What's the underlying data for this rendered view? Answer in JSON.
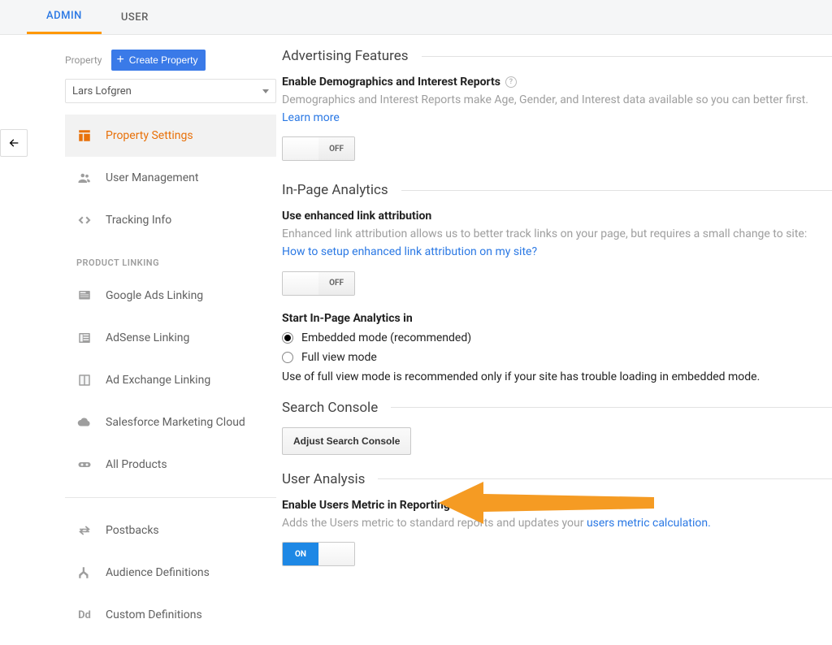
{
  "tabs": {
    "admin": "ADMIN",
    "user": "USER"
  },
  "sidebar": {
    "property_label": "Property",
    "create_btn": "Create Property",
    "selected_property": "Lars Lofgren",
    "items": {
      "settings": "Property Settings",
      "users": "User Management",
      "tracking": "Tracking Info",
      "linking_header": "PRODUCT LINKING",
      "ads": "Google Ads Linking",
      "adsense": "AdSense Linking",
      "adx": "Ad Exchange Linking",
      "sfmc": "Salesforce Marketing Cloud",
      "all": "All Products",
      "postbacks": "Postbacks",
      "audience": "Audience Definitions",
      "custom": "Custom Definitions"
    }
  },
  "sections": {
    "adv": {
      "title": "Advertising Features",
      "demo_label": "Enable Demographics and Interest Reports",
      "demo_desc": "Demographics and Interest Reports make Age, Gender, and Interest data available so you can better first. ",
      "learn_more": "Learn more",
      "off": "OFF"
    },
    "inpage": {
      "title": "In-Page Analytics",
      "ela_label": "Use enhanced link attribution",
      "ela_desc": "Enhanced link attribution allows us to better track links on your page, but requires a small change to site: ",
      "ela_link": "How to setup enhanced link attribution on my site?",
      "off": "OFF",
      "start_label": "Start In-Page Analytics in",
      "opt_embedded": "Embedded mode (recommended)",
      "opt_full": "Full view mode",
      "note": "Use of full view mode is recommended only if your site has trouble loading in embedded mode."
    },
    "sc": {
      "title": "Search Console",
      "btn": "Adjust Search Console"
    },
    "ua": {
      "title": "User Analysis",
      "label": "Enable Users Metric in Reporting",
      "desc": "Adds the Users metric to standard reports and updates your ",
      "link": "users metric calculation.",
      "on": "ON"
    }
  }
}
